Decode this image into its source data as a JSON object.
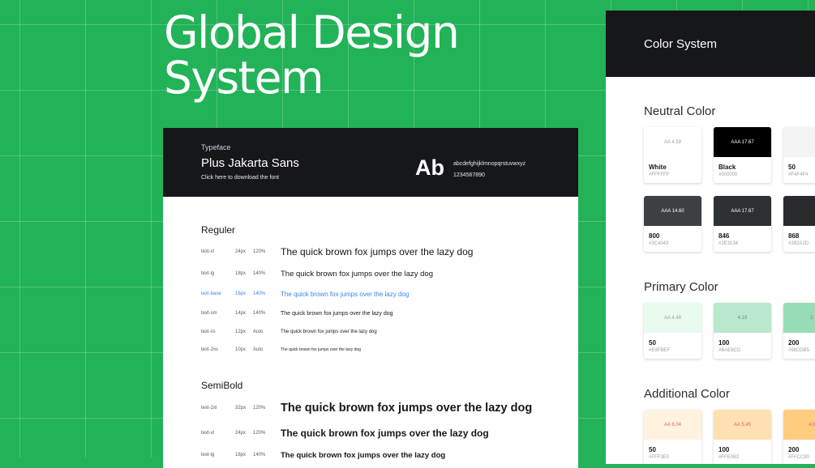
{
  "hero": {
    "line1": "Global Design",
    "line2": "System"
  },
  "typography": {
    "typeface_label": "Typeface",
    "font_name": "Plus Jakarta Sans",
    "download_link": "Click here to download the font",
    "ab": "Ab",
    "alphabet": "abcdefghijklmnopqrstuvwxyz",
    "numbers": "1234567890",
    "regular_title": "Reguler",
    "regular_rows": [
      {
        "name": "text-xl",
        "size": "24px",
        "lh": "120%",
        "sample": "The quick brown fox jumps over the lazy dog"
      },
      {
        "name": "text-lg",
        "size": "18px",
        "lh": "140%",
        "sample": "The quick brown fox jumps over the lazy dog"
      },
      {
        "name": "text-base",
        "size": "16px",
        "lh": "140%",
        "sample": "The quick brown fox jumps over the lazy dog"
      },
      {
        "name": "text-sm",
        "size": "14px",
        "lh": "140%",
        "sample": "The quick brown fox jumps over the lazy dog"
      },
      {
        "name": "text-xs",
        "size": "12px",
        "lh": "Auto",
        "sample": "The quick brown fox jumps over the lazy dog"
      },
      {
        "name": "text-2xs",
        "size": "10px",
        "lh": "Auto",
        "sample": "The quick brown fox jumps over the lazy dog"
      }
    ],
    "semibold_title": "SemiBold",
    "semibold_rows": [
      {
        "name": "text-2xl",
        "size": "32px",
        "lh": "120%",
        "sample": "The quick brown fox jumps over the lazy dog"
      },
      {
        "name": "text-xl",
        "size": "24px",
        "lh": "120%",
        "sample": "The quick brown fox jumps over the lazy dog"
      },
      {
        "name": "text-lg",
        "size": "18px",
        "lh": "140%",
        "sample": "The quick brown fox jumps over the lazy dog"
      }
    ]
  },
  "color_system": {
    "title": "Color System",
    "neutral_title": "Neutral Color",
    "neutral": [
      {
        "label": "AA 4.59",
        "name": "White",
        "hex": "#FFFFFF",
        "color": "#FFFFFF",
        "text": "#9aa0a6"
      },
      {
        "label": "AAA 17.67",
        "name": "Black",
        "hex": "#000000",
        "color": "#000000",
        "text": "#ffffff"
      },
      {
        "label": "",
        "name": "50",
        "hex": "#F4F4F4",
        "color": "#F4F4F4",
        "text": "#9aa0a6"
      },
      {
        "label": "AAA 14.60",
        "name": "800",
        "hex": "#3C4043",
        "color": "#3C4043",
        "text": "#ffffff"
      },
      {
        "label": "AAA 17.67",
        "name": "846",
        "hex": "#2E3134",
        "color": "#2E3134",
        "text": "#ffffff"
      },
      {
        "label": "",
        "name": "868",
        "hex": "#282A2D",
        "color": "#282A2D",
        "text": "#ffffff"
      }
    ],
    "primary_title": "Primary Color",
    "primary": [
      {
        "label": "AA 4.49",
        "name": "50",
        "hex": "#E9FBEF",
        "color": "#E9FBEF",
        "text": "#8aa396"
      },
      {
        "label": "4.18",
        "name": "100",
        "hex": "#BAE8CD",
        "color": "#BAE8CD",
        "text": "#6f8f7d"
      },
      {
        "label": "3.",
        "name": "200",
        "hex": "#98DDB5",
        "color": "#98DDB5",
        "text": "#6f8f7d"
      }
    ],
    "additional_title": "Additional Color",
    "additional": [
      {
        "label": "AA 6.04",
        "name": "50",
        "hex": "#FFF3E0",
        "color": "#FFF3E0",
        "text": "#d26a5a"
      },
      {
        "label": "AA 5.45",
        "name": "100",
        "hex": "#FFE0B2",
        "color": "#FFE0B2",
        "text": "#d26a5a"
      },
      {
        "label": "4.6",
        "name": "200",
        "hex": "#FFCC80",
        "color": "#FFCC80",
        "text": "#d26a5a"
      }
    ]
  }
}
